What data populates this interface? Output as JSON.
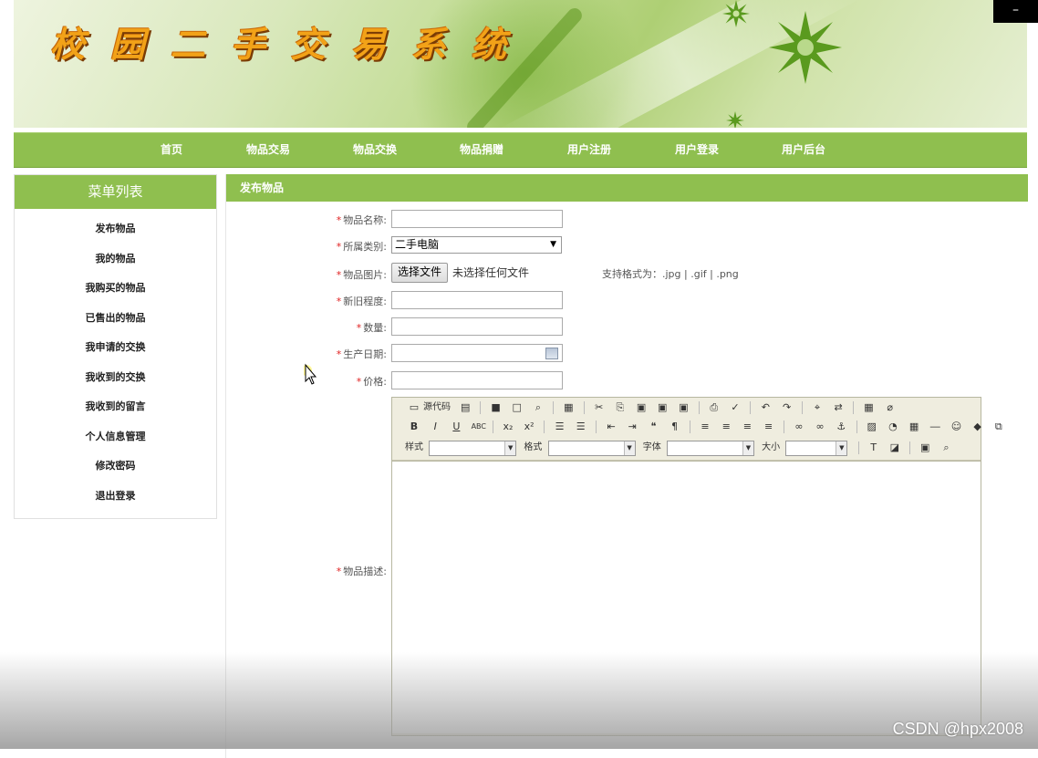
{
  "window": {
    "minimize_glyph": "–"
  },
  "site": {
    "title": "校园二手交易系统"
  },
  "nav": {
    "items": [
      "首页",
      "物品交易",
      "物品交换",
      "物品捐赠",
      "用户注册",
      "用户登录",
      "用户后台"
    ]
  },
  "sidebar": {
    "title": "菜单列表",
    "items": [
      "发布物品",
      "我的物品",
      "我购买的物品",
      "已售出的物品",
      "我申请的交换",
      "我收到的交换",
      "我收到的留言",
      "个人信息管理",
      "修改密码",
      "退出登录"
    ]
  },
  "main": {
    "title": "发布物品",
    "form": {
      "required_mark": "*",
      "name_label": "物品名称:",
      "name_value": "",
      "category_label": "所属类别:",
      "category_value": "二手电脑",
      "image_label": "物品图片:",
      "file_button": "选择文件",
      "file_status": "未选择任何文件",
      "file_hint": "支持格式为：.jpg | .gif | .png",
      "condition_label": "新旧程度:",
      "condition_value": "",
      "quantity_label": "数量:",
      "quantity_value": "",
      "date_label": "生产日期:",
      "date_value": "",
      "price_label": "价格:",
      "price_value": "",
      "description_label": "物品描述:"
    },
    "editor": {
      "source_label": "源代码",
      "style_label": "样式",
      "format_label": "格式",
      "font_label": "字体",
      "size_label": "大小"
    }
  },
  "watermark": "CSDN @hpx2008",
  "colors": {
    "accent": "#8fbf4f",
    "title": "#f2a218",
    "required": "#e02020"
  }
}
